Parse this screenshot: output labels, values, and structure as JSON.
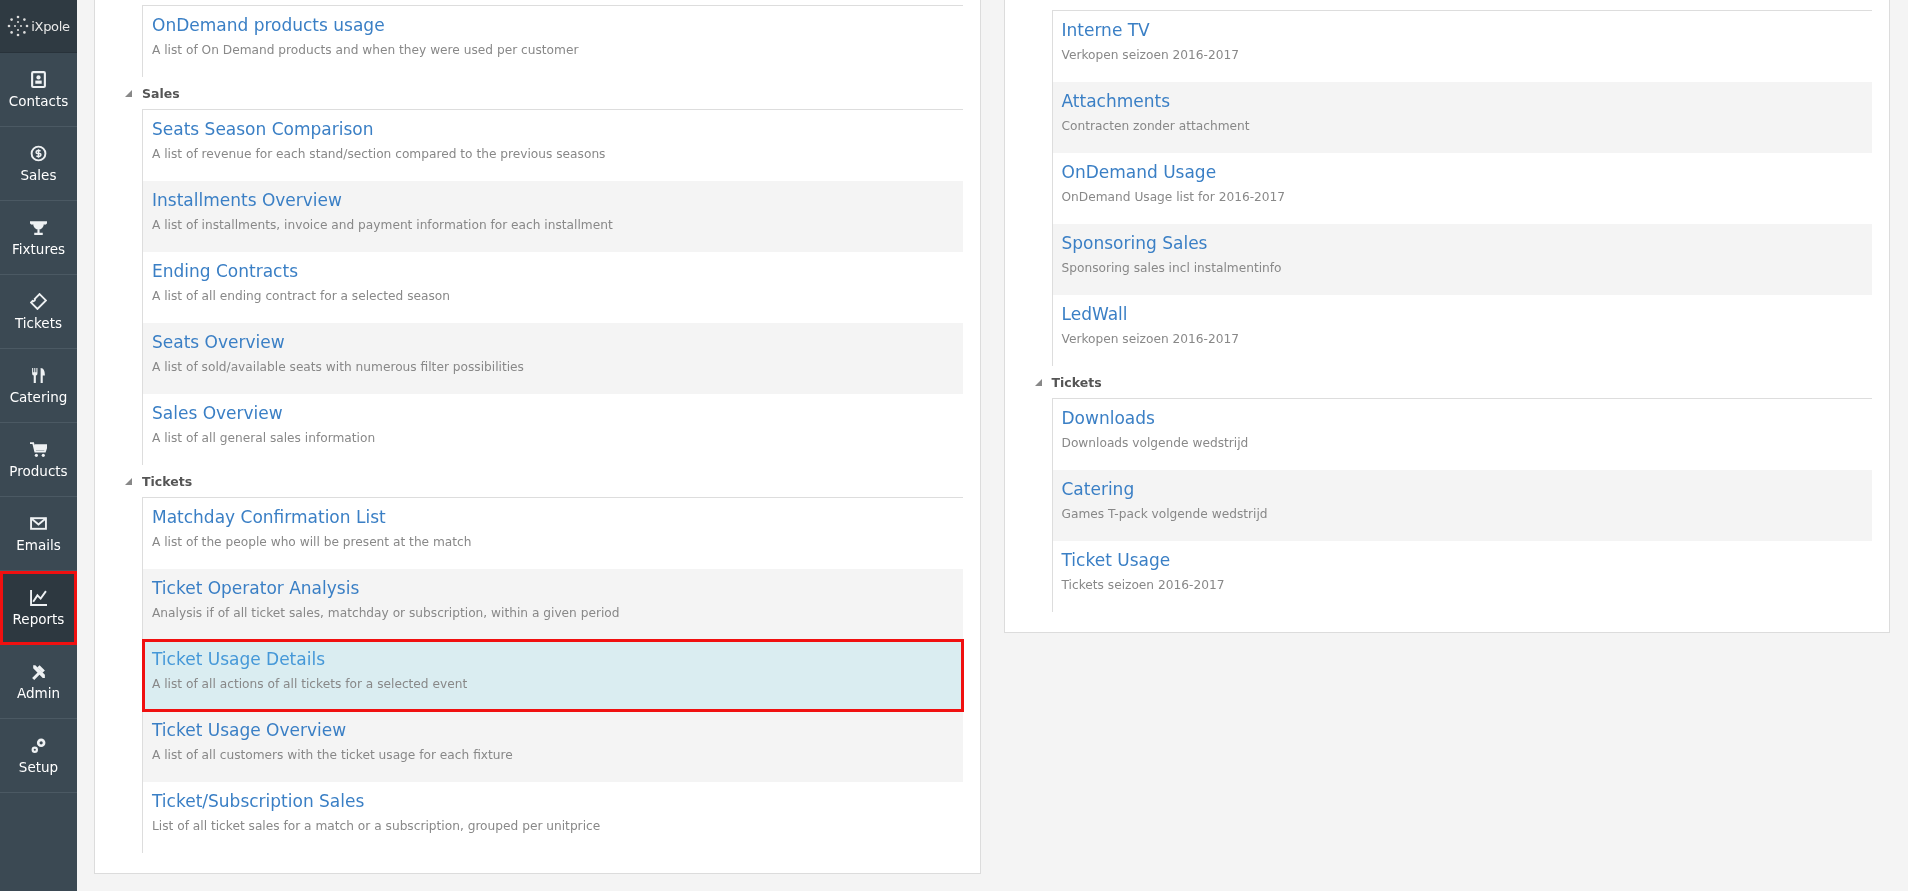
{
  "sidebar": {
    "logo": "iXpole",
    "items": [
      {
        "label": "Contacts",
        "selected": false
      },
      {
        "label": "Sales",
        "selected": false
      },
      {
        "label": "Fixtures",
        "selected": false
      },
      {
        "label": "Tickets",
        "selected": false
      },
      {
        "label": "Catering",
        "selected": false
      },
      {
        "label": "Products",
        "selected": false
      },
      {
        "label": "Emails",
        "selected": false
      },
      {
        "label": "Reports",
        "selected": true
      },
      {
        "label": "Admin",
        "selected": false
      },
      {
        "label": "Setup",
        "selected": false
      }
    ]
  },
  "left_panel": {
    "groups": [
      {
        "reports": [
          {
            "title": "OnDemand products usage",
            "description": "A list of On Demand products and when they were used per customer",
            "selected": false
          }
        ]
      },
      {
        "title": "Sales",
        "expanded": true,
        "reports": [
          {
            "title": "Seats Season Comparison",
            "description": "A list of revenue for each stand/section compared to the previous seasons",
            "selected": false
          },
          {
            "title": "Installments Overview",
            "description": "A list of installments, invoice and payment information for each installment",
            "selected": false
          },
          {
            "title": "Ending Contracts",
            "description": "A list of all ending contract for a selected season",
            "selected": false
          },
          {
            "title": "Seats Overview",
            "description": "A list of sold/available seats with numerous filter possibilities",
            "selected": false
          },
          {
            "title": "Sales Overview",
            "description": "A list of all general sales information",
            "selected": false
          }
        ]
      },
      {
        "title": "Tickets",
        "expanded": true,
        "reports": [
          {
            "title": "Matchday Confirmation List",
            "description": "A list of the people who will be present at the match",
            "selected": false
          },
          {
            "title": "Ticket Operator Analysis",
            "description": "Analysis if of all ticket sales, matchday or subscription, within a given period",
            "selected": false
          },
          {
            "title": "Ticket Usage Details",
            "description": "A list of all actions of all tickets for a selected event",
            "selected": true
          },
          {
            "title": "Ticket Usage Overview",
            "description": "A list of all customers with the ticket usage for each fixture",
            "selected": false
          },
          {
            "title": "Ticket/Subscription Sales",
            "description": "List of all ticket sales for a match or a subscription, grouped per unitprice",
            "selected": false
          }
        ]
      }
    ]
  },
  "right_panel": {
    "groups": [
      {
        "reports": [
          {
            "title": "Interne TV",
            "description": "Verkopen seizoen 2016-2017",
            "selected": false
          },
          {
            "title": "Attachments",
            "description": "Contracten zonder attachment",
            "selected": false
          },
          {
            "title": "OnDemand Usage",
            "description": "OnDemand Usage list for 2016-2017",
            "selected": false
          },
          {
            "title": "Sponsoring Sales",
            "description": "Sponsoring sales incl instalmentinfo",
            "selected": false
          },
          {
            "title": "LedWall",
            "description": "Verkopen seizoen 2016-2017",
            "selected": false
          }
        ]
      },
      {
        "title": "Tickets",
        "expanded": true,
        "reports": [
          {
            "title": "Downloads",
            "description": "Downloads volgende wedstrijd",
            "selected": false
          },
          {
            "title": "Catering",
            "description": "Games T-pack volgende wedstrijd",
            "selected": false
          },
          {
            "title": "Ticket Usage",
            "description": "Tickets seizoen 2016-2017",
            "selected": false
          }
        ]
      }
    ]
  }
}
